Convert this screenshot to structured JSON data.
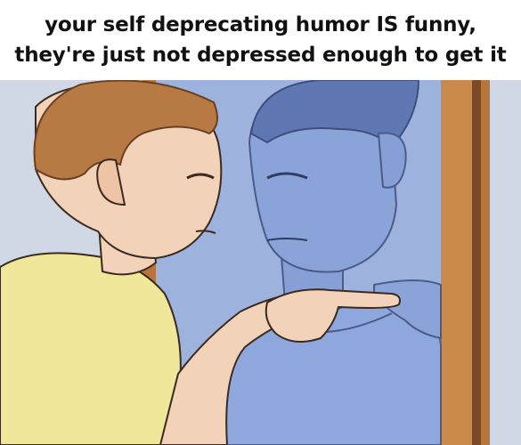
{
  "caption": {
    "line1": "your self deprecating humor IS funny,",
    "line2": "they're just not depressed enough to get it"
  },
  "colors": {
    "wall": "#c9d3e0",
    "mirror_frame": "#b8743a",
    "reflection": "#8aa3d8",
    "reflection_shadow": "#6d86c0",
    "skin": "#f2d2b8",
    "hair": "#b77a45",
    "shirt": "#f3ea9a",
    "outline": "#3a2a20"
  },
  "icons": [
    "man-icon",
    "mirror-icon",
    "reflection-icon"
  ]
}
